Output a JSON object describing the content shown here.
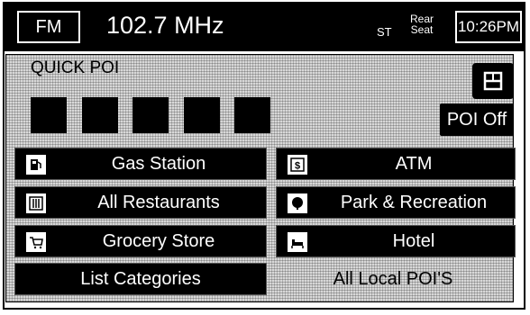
{
  "status_bar": {
    "band": "FM",
    "frequency": "102.7 MHz",
    "stereo_indicator": "ST",
    "rear_seat_line1": "Rear",
    "rear_seat_line2": "Seat",
    "clock": "10:26PM"
  },
  "panel": {
    "title": "QUICK POI",
    "poi_off_label": "POI Off",
    "slots_count": 5
  },
  "categories": {
    "left": [
      {
        "label": "Gas Station",
        "icon": "gas-pump-icon"
      },
      {
        "label": "All Restaurants",
        "icon": "fork-knife-icon"
      },
      {
        "label": "Grocery Store",
        "icon": "shopping-cart-icon"
      }
    ],
    "right": [
      {
        "label": "ATM",
        "icon": "dollar-sign-icon"
      },
      {
        "label": "Park & Recreation",
        "icon": "tree-icon"
      },
      {
        "label": "Hotel",
        "icon": "bed-icon"
      }
    ],
    "list_categories_label": "List Categories",
    "all_local_label": "All Local POI'S"
  }
}
